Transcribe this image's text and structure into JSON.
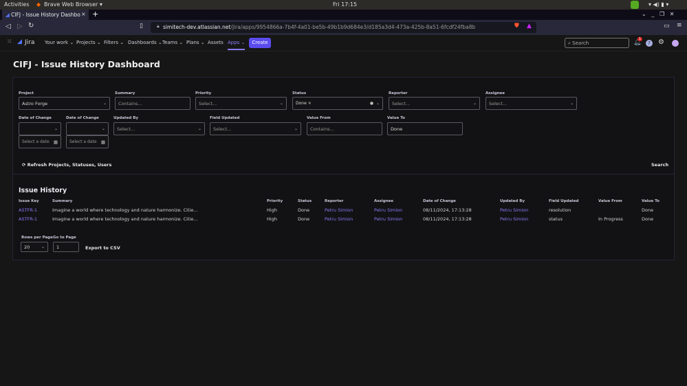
{
  "os": {
    "activities": "Activities",
    "app": "Brave Web Browser ▾",
    "clock": "Fri 17:15"
  },
  "browser": {
    "tab_title": "CIFJ - Issue History Dashbo",
    "url_host": "simitech-dev.atlassian.net",
    "url_path": "/jira/apps/9954866a-7b4f-4a01-be5b-49b1b9d684e3/d185a3d4-473a-425b-8a51-6fcdf24fba8b"
  },
  "jira": {
    "logo": "Jira",
    "nav": [
      "Your work",
      "Projects",
      "Filters",
      "Dashboards",
      "Teams",
      "Plans",
      "Assets",
      "Apps"
    ],
    "create": "Create",
    "search_placeholder": "Search",
    "notif_count": "1",
    "accent": "#5b4cf0"
  },
  "page": {
    "title": "CIFJ - Issue History Dashboard"
  },
  "filters": {
    "project": {
      "label": "Project",
      "value": "Astro Forge"
    },
    "summary": {
      "label": "Summary",
      "placeholder": "Contains..."
    },
    "priority": {
      "label": "Priority",
      "placeholder": "Select..."
    },
    "status": {
      "label": "Status",
      "chip": "Done"
    },
    "reporter": {
      "label": "Reporter",
      "placeholder": "Select..."
    },
    "assignee": {
      "label": "Assignee",
      "placeholder": "Select..."
    },
    "date_from": {
      "label": "Date of Change",
      "placeholder": "Select a date"
    },
    "date_to": {
      "label": "Date of Change",
      "placeholder": "Select a date"
    },
    "updated_by": {
      "label": "Updated By",
      "placeholder": "Select..."
    },
    "field_updated": {
      "label": "Field Updated",
      "placeholder": "Select..."
    },
    "value_from": {
      "label": "Value From",
      "placeholder": "Contains..."
    },
    "value_to": {
      "label": "Value To",
      "value": "Done"
    },
    "refresh": "Refresh Projects, Statuses, Users",
    "search": "Search"
  },
  "history": {
    "title": "Issue History",
    "columns": [
      "Issue Key",
      "Summary",
      "Priority",
      "Status",
      "Reporter",
      "Assignee",
      "Date of Change",
      "Updated By",
      "Field Updated",
      "Value From",
      "Value To"
    ],
    "rows": [
      [
        "ASTFR-1",
        "Imagine a world where technology and nature harmonize. Citie...",
        "High",
        "Done",
        "Petru Simion",
        "Petru Simion",
        "08/11/2024, 17:13:28",
        "Petru Simion",
        "resolution",
        "",
        "Done"
      ],
      [
        "ASTFR-1",
        "Imagine a world where technology and nature harmonize. Citie...",
        "High",
        "Done",
        "Petru Simion",
        "Petru Simion",
        "08/11/2024, 17:13:28",
        "Petru Simion",
        "status",
        "In Progress",
        "Done"
      ]
    ],
    "rows_per_page_label": "Rows per Page",
    "rows_per_page": "20",
    "goto_label": "Go to Page",
    "goto_value": "1",
    "export": "Export to CSV"
  }
}
